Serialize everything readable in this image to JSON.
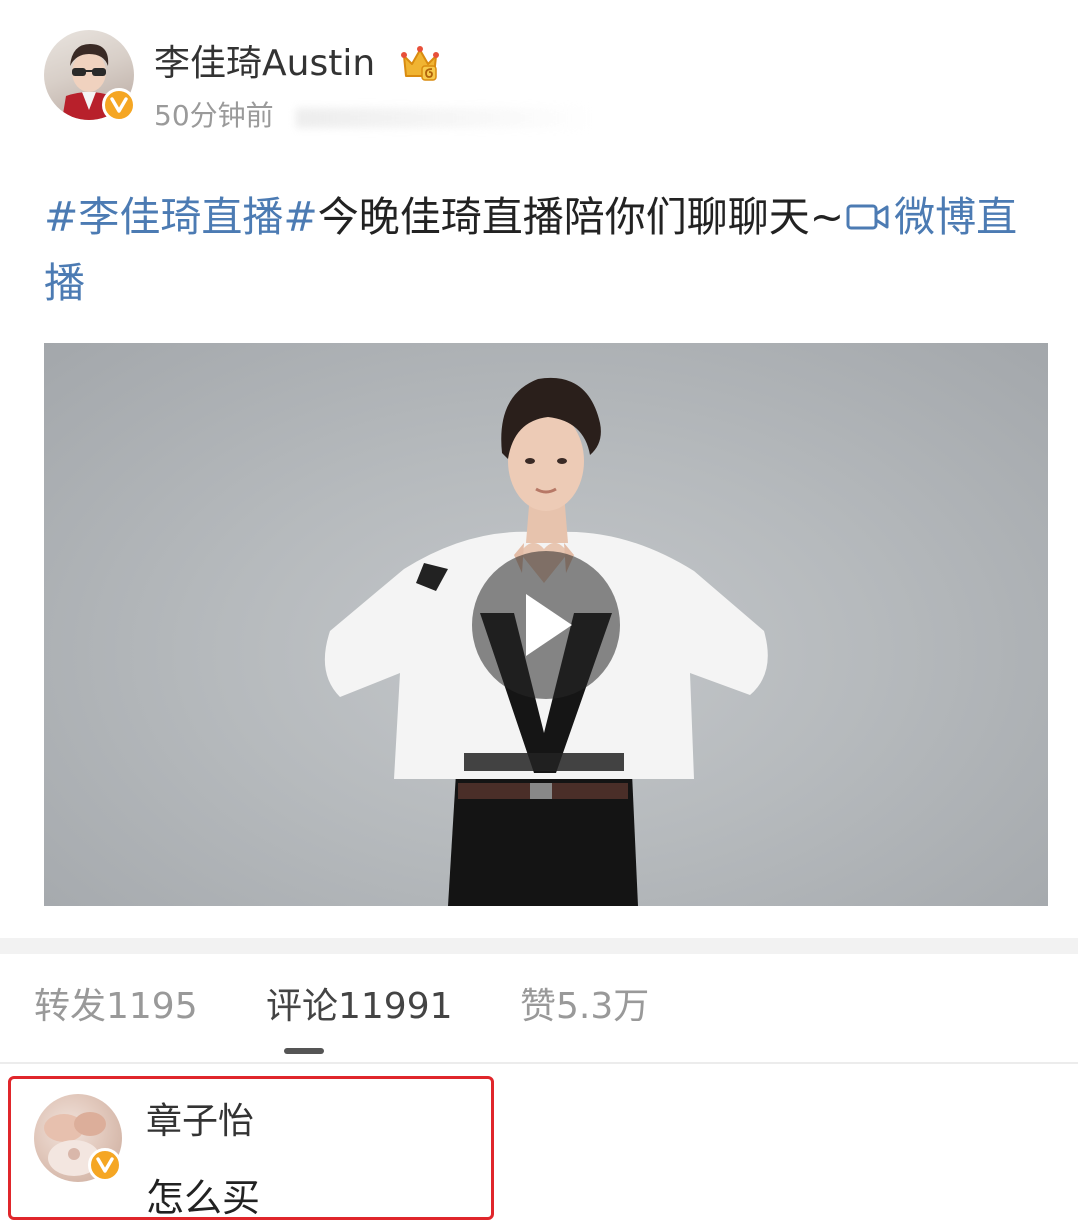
{
  "post": {
    "author": "李佳琦Austin",
    "time": "50分钟前",
    "hashtag": "#李佳琦直播#",
    "text": "今晚佳琦直播陪你们聊聊天~",
    "live_link": "微博直播",
    "media": {
      "type": "video",
      "play_icon": "play-icon"
    },
    "badges": {
      "verified": "verified-v-icon",
      "level": "crown-level-icon"
    }
  },
  "tabs": [
    {
      "label": "转发1195",
      "active": false
    },
    {
      "label": "评论11991",
      "active": true
    },
    {
      "label": "赞5.3万",
      "active": false
    }
  ],
  "comment": {
    "user": "章子怡",
    "text": "怎么买",
    "verified": true
  },
  "colors": {
    "link": "#4c7bb3",
    "verified_badge": "#f5a623",
    "highlight_border": "#e0262b"
  }
}
